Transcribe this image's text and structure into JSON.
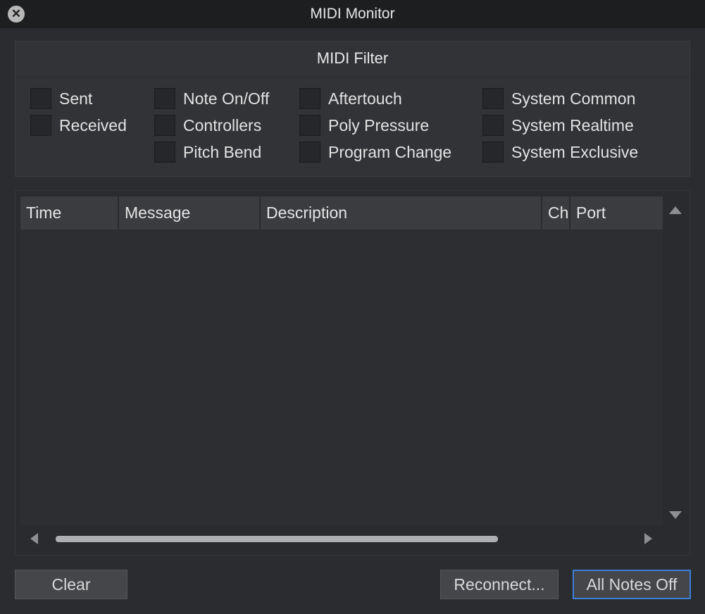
{
  "window": {
    "title": "MIDI Monitor"
  },
  "filter": {
    "title": "MIDI Filter",
    "columns": [
      [
        "Sent",
        "Received"
      ],
      [
        "Note On/Off",
        "Controllers",
        "Pitch Bend"
      ],
      [
        "Aftertouch",
        "Poly Pressure",
        "Program Change"
      ],
      [
        "System Common",
        "System Realtime",
        "System Exclusive"
      ]
    ],
    "checked": {
      "Sent": false,
      "Received": false,
      "Note On/Off": false,
      "Controllers": false,
      "Pitch Bend": false,
      "Aftertouch": false,
      "Poly Pressure": false,
      "Program Change": false,
      "System Common": false,
      "System Realtime": false,
      "System Exclusive": false
    }
  },
  "table": {
    "columns": [
      "Time",
      "Message",
      "Description",
      "Ch",
      "Port"
    ],
    "rows": []
  },
  "buttons": {
    "clear": "Clear",
    "reconnect": "Reconnect...",
    "all_notes_off": "All Notes Off"
  },
  "icons": {
    "close": "close-icon",
    "scroll_up": "chevron-up-icon",
    "scroll_down": "chevron-down-icon",
    "scroll_left": "chevron-left-icon",
    "scroll_right": "chevron-right-icon"
  },
  "colors": {
    "focus_ring": "#3b7fd9",
    "background": "#2b2c2f"
  }
}
